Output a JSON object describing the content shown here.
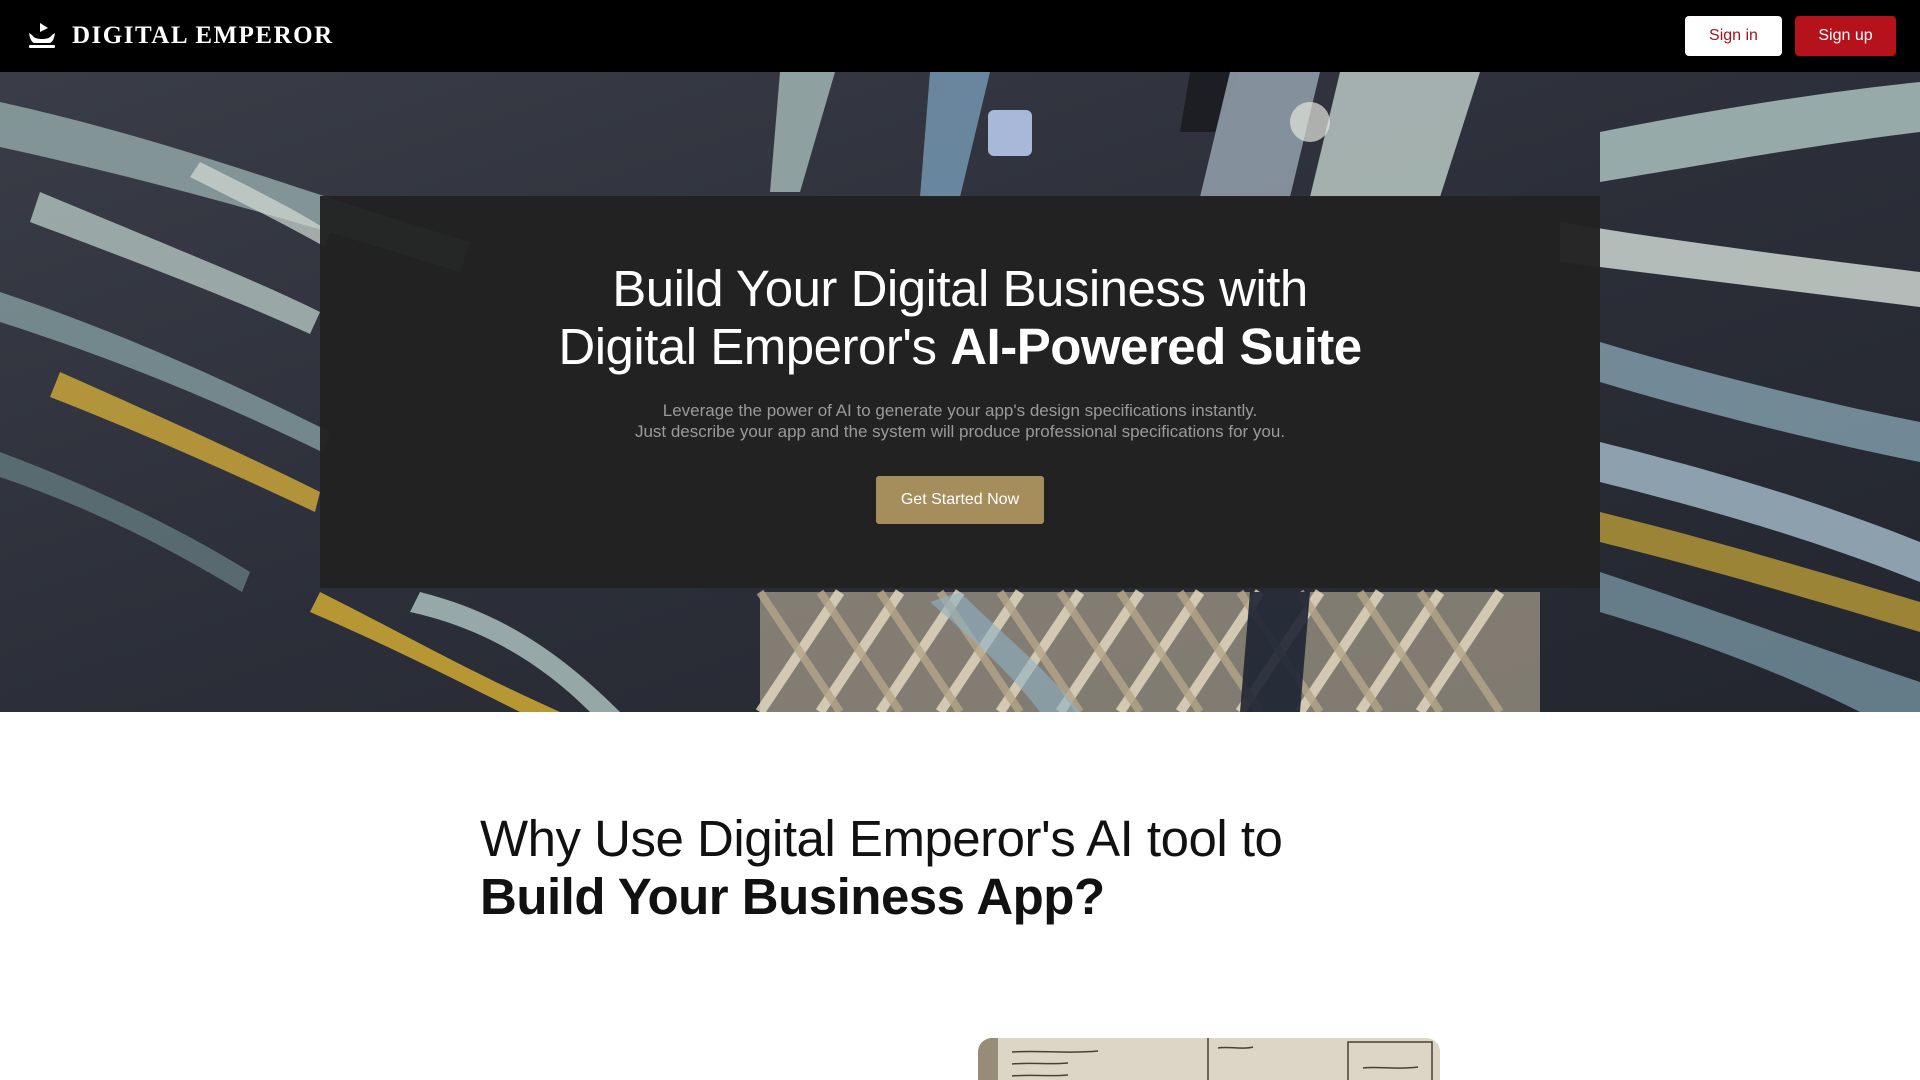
{
  "topbar": {
    "brand_name": "DIGITAL EMPEROR",
    "brand_icon": "crown-icon",
    "signin_label": "Sign in",
    "signup_label": "Sign up"
  },
  "hero": {
    "title_line1": "Build Your Digital Business with",
    "title_line2_light": "Digital Emperor's",
    "title_line2_bold": "AI-Powered Suite",
    "subtitle_line1": "Leverage the power of AI to generate your app's design specifications instantly.",
    "subtitle_line2": "Just describe your app and the system will produce professional specifications for you.",
    "cta_label": "Get Started Now"
  },
  "why": {
    "title_light": "Why Use Digital Emperor's AI tool to",
    "title_bold": "Build Your Business App?"
  },
  "colors": {
    "topbar_bg": "#000000",
    "signin_text": "#a4121a",
    "signup_bg": "#b5121b",
    "cta_bg": "#a58d5c",
    "hero_panel_bg": "#222222"
  }
}
